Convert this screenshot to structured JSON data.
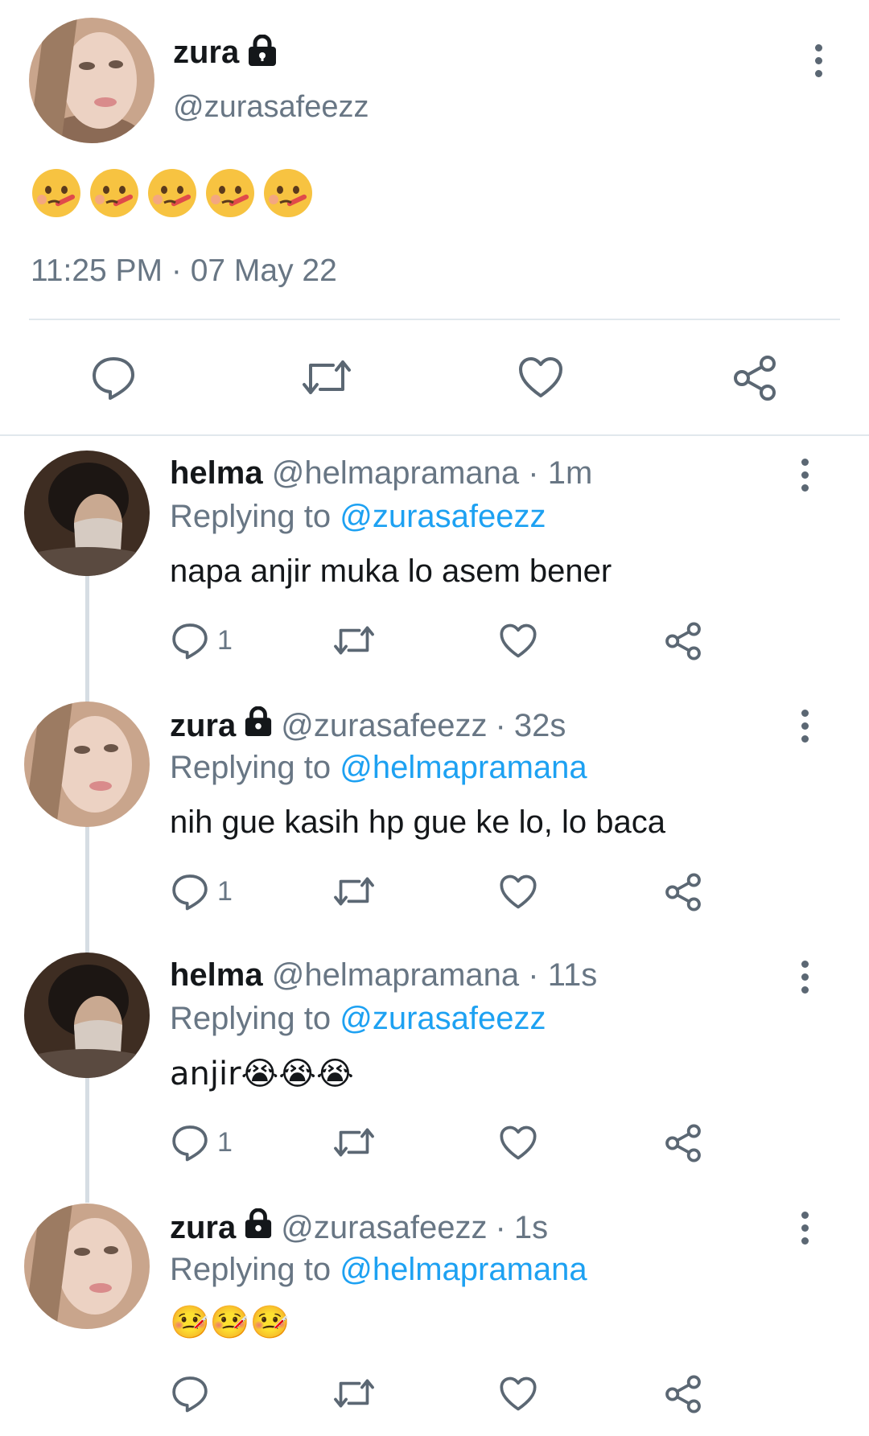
{
  "main_tweet": {
    "name": "zura",
    "handle": "@zurasafeezz",
    "timestamp": "11:25 PM · 07 May 22",
    "emoji_count": 5
  },
  "icons": {
    "reply": "reply-icon",
    "retweet": "retweet-icon",
    "like": "heart-icon",
    "share": "share-icon",
    "more": "more-vertical-icon",
    "lock": "lock-icon"
  },
  "replies": [
    {
      "name": "helma",
      "handle": "@helmapramana",
      "time": "1m",
      "replying_label": "Replying to",
      "replying_to": "@zurasafeezz",
      "text": "napa anjir muka lo asem bener",
      "reply_count": "1",
      "locked": false
    },
    {
      "name": "zura",
      "handle": "@zurasafeezz",
      "time": "32s",
      "replying_label": "Replying to",
      "replying_to": "@helmapramana",
      "text": "nih gue kasih hp gue ke lo, lo baca",
      "reply_count": "1",
      "locked": true
    },
    {
      "name": "helma",
      "handle": "@helmapramana",
      "time": "11s",
      "replying_label": "Replying to",
      "replying_to": "@zurasafeezz",
      "text": "anjir😭😭😭",
      "reply_count": "1",
      "locked": false
    },
    {
      "name": "zura",
      "handle": "@zurasafeezz",
      "time": "1s",
      "replying_label": "Replying to",
      "replying_to": "@helmapramana",
      "text": "🤒🤒🤒",
      "reply_count": "",
      "locked": true
    }
  ],
  "colors": {
    "accent": "#1da1f2",
    "secondary_text": "#687684",
    "icon": "#5b6773",
    "divider": "#e1e8ed"
  }
}
